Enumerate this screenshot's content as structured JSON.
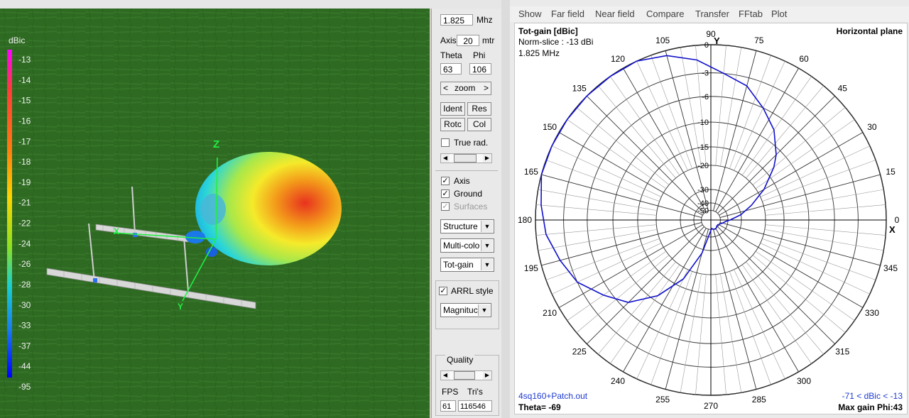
{
  "viewport": {
    "scale_unit": "dBic",
    "scale_labels": [
      "-13",
      "-14",
      "-15",
      "-16",
      "-17",
      "-18",
      "-19",
      "-21",
      "-22",
      "-24",
      "-26",
      "-28",
      "-30",
      "-33",
      "-37",
      "-44",
      "-95"
    ],
    "axis_labels": {
      "z": "Z",
      "y": "Y",
      "x": "X"
    }
  },
  "panel": {
    "frequency": "1.825",
    "frequency_unit": "Mhz",
    "axis_label": "Axis",
    "axis_value": "20",
    "axis_unit": "mtr",
    "theta_label": "Theta",
    "phi_label": "Phi",
    "theta_value": "63",
    "phi_value": "106",
    "zoom_label": "zoom",
    "zoom_left": "<",
    "zoom_right": ">",
    "ident_label": "Ident",
    "res_label": "Res",
    "rotc_label": "Rotc",
    "col_label": "Col",
    "true_rad_label": "True rad.",
    "true_rad_checked": false,
    "axis_check_label": "Axis",
    "axis_checked": true,
    "ground_label": "Ground",
    "ground_checked": true,
    "surfaces_label": "Surfaces",
    "surfaces_checked": true,
    "structure_select": "Structure",
    "color_select": "Multi-colo",
    "gain_select": "Tot-gain",
    "arrl_label": "ARRL style",
    "arrl_checked": true,
    "magnitude_select": "Magnituc",
    "quality_label": "Quality",
    "fps_label": "FPS",
    "tris_label": "Tri's",
    "fps_value": "61",
    "tris_value": "116546",
    "check_mark": "✓",
    "dropdown_glyph": "▼",
    "scroll_left_glyph": "◀",
    "scroll_right_glyph": "▶"
  },
  "menu": [
    "Show",
    "Far field",
    "Near field",
    "Compare",
    "Transfer",
    "FFtab",
    "Plot"
  ],
  "plot": {
    "title": "Tot-gain [dBic]",
    "norm_slice": "Norm-slice : -13 dBi",
    "frequency": "1.825 MHz",
    "plane": "Horizontal plane",
    "file": "4sq160+Patch.out",
    "range": "-71 < dBic < -13",
    "theta": "Theta= -69",
    "max_gain": "Max gain Phi:43",
    "axis_x": "X",
    "axis_y": "Y",
    "pattern_color": "#1010cc"
  },
  "chart_data": {
    "type": "polar",
    "title": "Tot-gain [dBic]",
    "plane": "Horizontal plane",
    "angle_ticks": [
      0,
      15,
      30,
      45,
      60,
      75,
      90,
      105,
      120,
      135,
      150,
      165,
      180,
      195,
      210,
      225,
      240,
      255,
      270,
      285,
      300,
      315,
      330,
      345
    ],
    "radial_ticks_db": [
      0,
      -3,
      -6,
      -10,
      -15,
      -20,
      -30,
      -40,
      -50
    ],
    "series": [
      {
        "values_deg_db": [
          [
            0,
            -38
          ],
          [
            10,
            -30
          ],
          [
            20,
            -24
          ],
          [
            30,
            -18
          ],
          [
            40,
            -13
          ],
          [
            45,
            -11
          ],
          [
            55,
            -8
          ],
          [
            65,
            -6
          ],
          [
            75,
            -4
          ],
          [
            85,
            -3
          ],
          [
            95,
            -1.5
          ],
          [
            105,
            -0.5
          ],
          [
            115,
            0
          ],
          [
            125,
            0
          ],
          [
            135,
            0
          ],
          [
            145,
            0
          ],
          [
            155,
            0
          ],
          [
            165,
            0
          ],
          [
            175,
            -0.5
          ],
          [
            185,
            -1
          ],
          [
            195,
            -2
          ],
          [
            205,
            -3
          ],
          [
            215,
            -5
          ],
          [
            225,
            -7
          ],
          [
            235,
            -11
          ],
          [
            245,
            -17
          ],
          [
            255,
            -28
          ],
          [
            265,
            -44
          ],
          [
            275,
            -52
          ],
          [
            285,
            -50
          ],
          [
            295,
            -49
          ],
          [
            305,
            -50
          ],
          [
            315,
            -52
          ],
          [
            325,
            -52
          ],
          [
            335,
            -50
          ],
          [
            345,
            -46
          ],
          [
            355,
            -42
          ],
          [
            360,
            -38
          ]
        ]
      }
    ]
  }
}
